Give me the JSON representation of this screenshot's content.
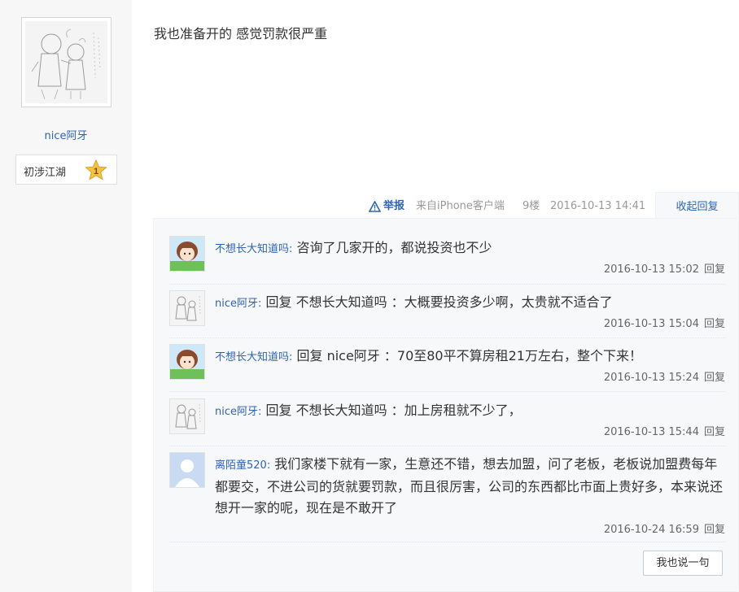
{
  "author": {
    "name": "nice阿牙",
    "level_title": "初涉江湖",
    "level_number": "1",
    "avatar_icon": "sketch-couple-avatar"
  },
  "post": {
    "content": "我也准备开的 感觉罚款很严重",
    "report_label": "举报",
    "source": "来自iPhone客户端",
    "floor": "9楼",
    "date": "2016-10-13 14:41",
    "collapse_label": "收起回复"
  },
  "replies": [
    {
      "user": "不想长大知道吗:",
      "text": "咨询了几家开的，都说投资也不少",
      "time": "2016-10-13 15:02",
      "reply_label": "回复",
      "avatar": "cartoon-girl-avatar"
    },
    {
      "user": "nice阿牙:",
      "text": "回复 不想长大知道吗 ：大概要投资多少啊，太贵就不适合了",
      "time": "2016-10-13 15:04",
      "reply_label": "回复",
      "avatar": "sketch-couple-avatar"
    },
    {
      "user": "不想长大知道吗:",
      "text": "回复 nice阿牙 ：70至80平不算房租21万左右，整个下来！",
      "time": "2016-10-13 15:24",
      "reply_label": "回复",
      "avatar": "cartoon-girl-avatar"
    },
    {
      "user": "nice阿牙:",
      "text": "回复 不想长大知道吗 ：加上房租就不少了，",
      "time": "2016-10-13 15:44",
      "reply_label": "回复",
      "avatar": "sketch-couple-avatar"
    },
    {
      "user": "离陌童520:",
      "text": "我们家楼下就有一家，生意还不错，想去加盟，问了老板，老板说加盟费每年都要交，不进公司的货就要罚款，而且很厉害，公司的东西都比市面上贵好多，本来说还想开一家的呢，现在是不敢开了",
      "time": "2016-10-24 16:59",
      "reply_label": "回复",
      "avatar": "default-user-avatar"
    }
  ],
  "say_button": "我也说一句",
  "colors": {
    "link": "#2d64b3",
    "reply_bg": "#f7f8fa",
    "star": "#f5c342"
  }
}
